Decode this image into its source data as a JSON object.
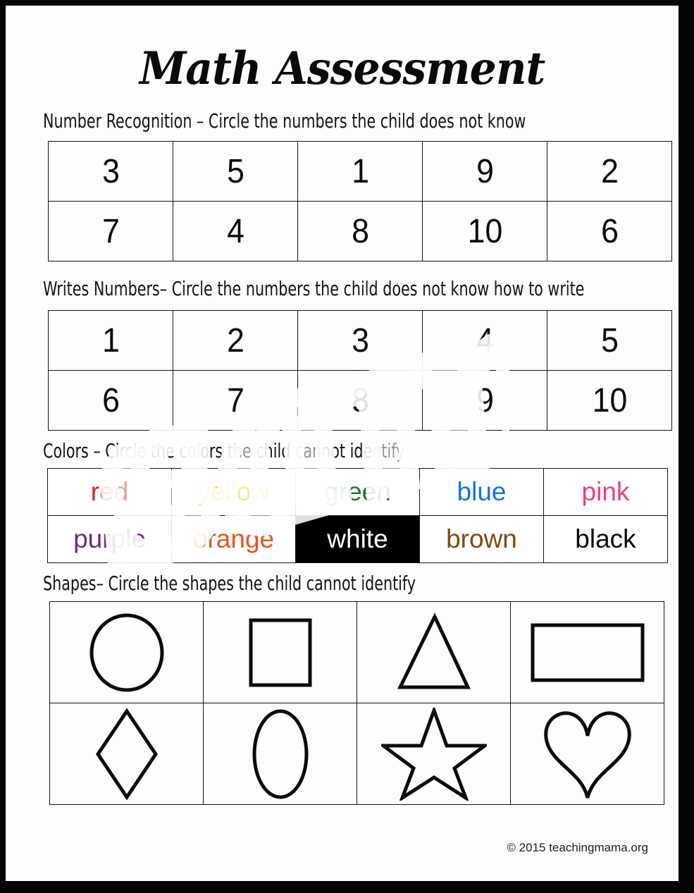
{
  "document": {
    "title": "Math Assessment",
    "watermark": "sample",
    "footer": "© 2015 teachingmama.org"
  },
  "sections": {
    "number_recognition": {
      "heading": "Number Recognition – Circle the numbers the child does not know",
      "rows": [
        [
          "3",
          "5",
          "1",
          "9",
          "2"
        ],
        [
          "7",
          "4",
          "8",
          "10",
          "6"
        ]
      ]
    },
    "writes_numbers": {
      "heading": "Writes Numbers– Circle the numbers the child does not know how to write",
      "rows": [
        [
          "1",
          "2",
          "3",
          "4",
          "5"
        ],
        [
          "6",
          "7",
          "8",
          "9",
          "10"
        ]
      ]
    },
    "colors": {
      "heading": "Colors –  Circle the colors the child cannot identify",
      "rows": [
        [
          {
            "label": "red",
            "color": "#D8222A",
            "bg": "#ffffff"
          },
          {
            "label": "yellow",
            "color": "#F2CC2B",
            "bg": "#ffffff"
          },
          {
            "label": "green",
            "color": "#1E7A32",
            "bg": "#ffffff"
          },
          {
            "label": "blue",
            "color": "#1673DB",
            "bg": "#ffffff"
          },
          {
            "label": "pink",
            "color": "#E8408A",
            "bg": "#ffffff"
          }
        ],
        [
          {
            "label": "purple",
            "color": "#6B2F73",
            "bg": "#ffffff"
          },
          {
            "label": "orange",
            "color": "#E8541B",
            "bg": "#ffffff"
          },
          {
            "label": "white",
            "color": "#ffffff",
            "bg": "#000000"
          },
          {
            "label": "brown",
            "color": "#7B4A12",
            "bg": "#ffffff"
          },
          {
            "label": "black",
            "color": "#0b0b0b",
            "bg": "#ffffff"
          }
        ]
      ]
    },
    "shapes": {
      "heading": "Shapes–  Circle the shapes the child cannot identify",
      "rows": [
        [
          "circle",
          "square",
          "triangle",
          "rectangle"
        ],
        [
          "diamond",
          "oval",
          "star",
          "heart"
        ]
      ]
    }
  }
}
